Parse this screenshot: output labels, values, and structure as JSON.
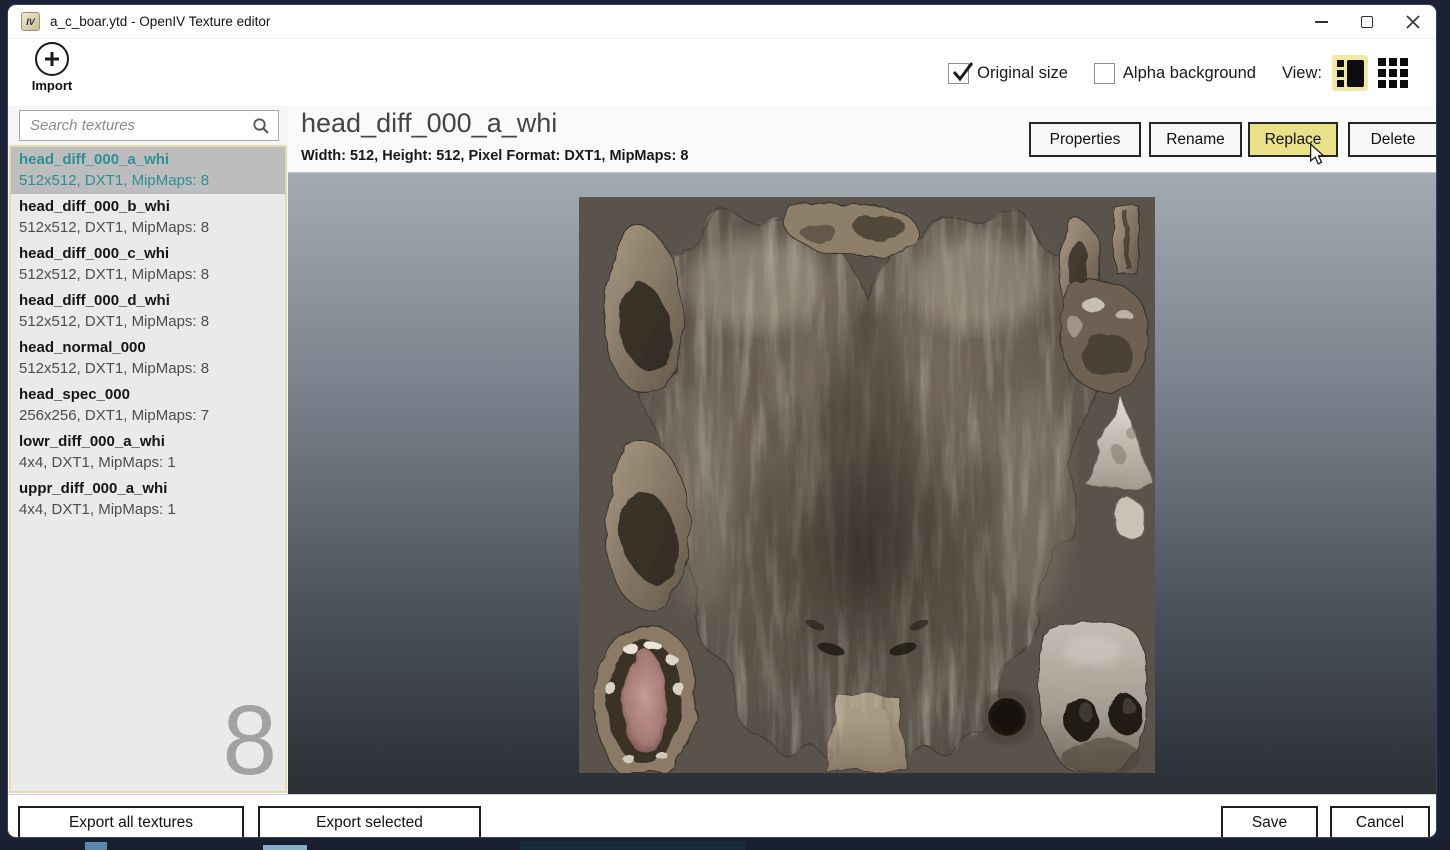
{
  "window": {
    "title": "a_c_boar.ytd - OpenIV Texture editor",
    "app_icon_text": "IV"
  },
  "toolbar": {
    "import_label": "Import",
    "original_size": {
      "label": "Original size",
      "checked": true
    },
    "alpha_background": {
      "label": "Alpha background",
      "checked": false
    },
    "view_label": "View:"
  },
  "sidebar": {
    "search_placeholder": "Search textures",
    "count_badge": "8",
    "items": [
      {
        "name": "head_diff_000_a_whi",
        "details": "512x512, DXT1, MipMaps: 8",
        "selected": true
      },
      {
        "name": "head_diff_000_b_whi",
        "details": "512x512, DXT1, MipMaps: 8",
        "selected": false
      },
      {
        "name": "head_diff_000_c_whi",
        "details": "512x512, DXT1, MipMaps: 8",
        "selected": false
      },
      {
        "name": "head_diff_000_d_whi",
        "details": "512x512, DXT1, MipMaps: 8",
        "selected": false
      },
      {
        "name": "head_normal_000",
        "details": "512x512, DXT1, MipMaps: 8",
        "selected": false
      },
      {
        "name": "head_spec_000",
        "details": "256x256, DXT1, MipMaps: 7",
        "selected": false
      },
      {
        "name": "lowr_diff_000_a_whi",
        "details": "4x4, DXT1, MipMaps: 1",
        "selected": false
      },
      {
        "name": "uppr_diff_000_a_whi",
        "details": "4x4, DXT1, MipMaps: 1",
        "selected": false
      }
    ]
  },
  "main": {
    "texture_title": "head_diff_000_a_whi",
    "texture_info": "Width: 512, Height: 512, Pixel Format: DXT1, MipMaps: 8",
    "buttons": {
      "properties": "Properties",
      "rename": "Rename",
      "replace": "Replace",
      "delete": "Delete"
    }
  },
  "footer": {
    "export_all": "Export all textures",
    "export_selected": "Export selected",
    "save": "Save",
    "cancel": "Cancel"
  },
  "colors": {
    "selected_item_text": "#2e8f96",
    "selected_item_bg": "#bdbdbd",
    "highlighted_button_bg": "#e9e187",
    "view_active_bg": "#f0e9a4",
    "preview_gradient_top": "#a2aab2",
    "preview_gradient_bottom": "#2a2e35",
    "texture_background": "#59534c"
  }
}
